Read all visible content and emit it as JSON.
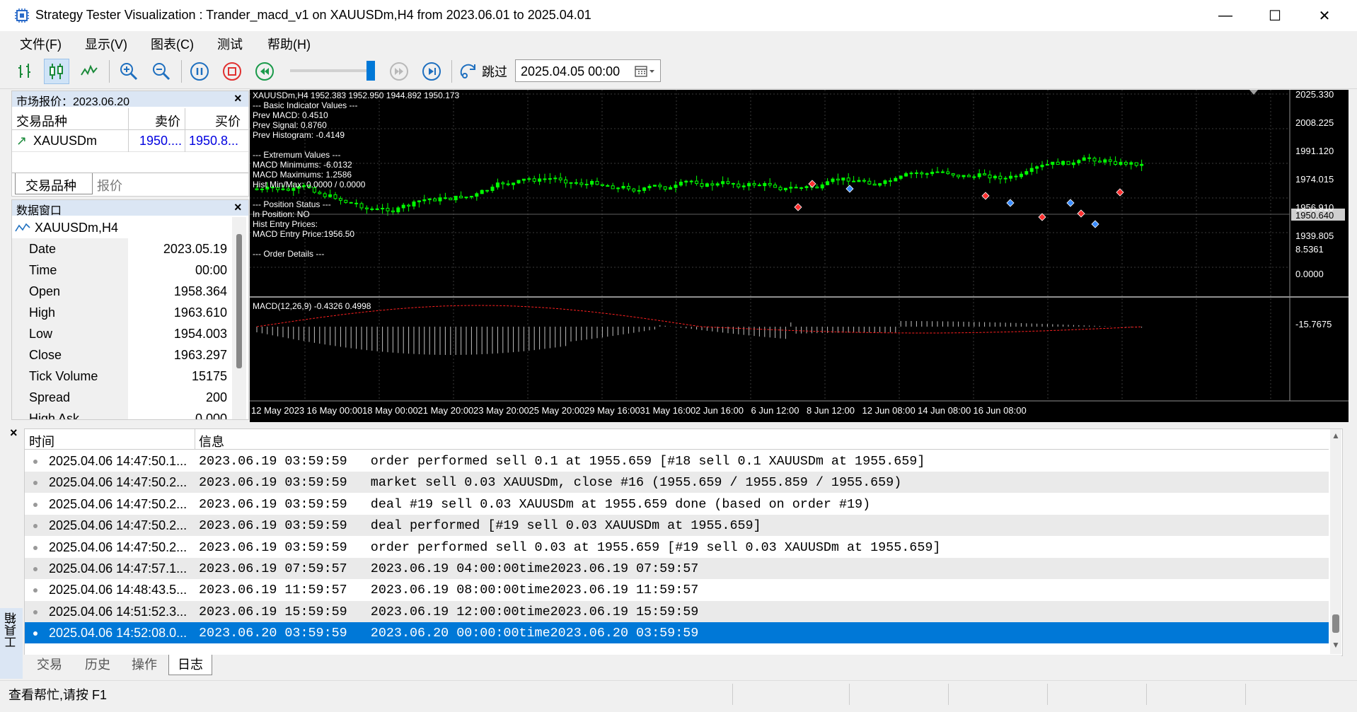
{
  "window": {
    "title": "Strategy Tester Visualization : Trander_macd_v1 on XAUUSDm,H4 from 2023.06.01 to 2025.04.01",
    "minimize_glyph": "—",
    "maximize_glyph": "☐",
    "close_glyph": "✕"
  },
  "menu": [
    "文件(F)",
    "显示(V)",
    "图表(C)",
    "测试",
    "帮助(H)"
  ],
  "toolbar": {
    "jump_label": "跳过",
    "date_value": "2025.04.05 00:00"
  },
  "market_watch": {
    "title": "市场报价：2023.06.20",
    "col_symbol": "交易品种",
    "col_bid": "卖价",
    "col_ask": "买价",
    "rows": [
      {
        "symbol": "XAUUSDm",
        "bid": "1950....",
        "ask": "1950.8..."
      }
    ],
    "tabs": [
      "交易品种",
      "报价"
    ]
  },
  "data_window": {
    "title": "数据窗口",
    "symbol": "XAUUSDm,H4",
    "rows": [
      {
        "label": "Date",
        "value": "2023.05.19"
      },
      {
        "label": "Time",
        "value": "00:00"
      },
      {
        "label": "Open",
        "value": "1958.364"
      },
      {
        "label": "High",
        "value": "1963.610"
      },
      {
        "label": "Low",
        "value": "1954.003"
      },
      {
        "label": "Close",
        "value": "1963.297"
      },
      {
        "label": "Tick Volume",
        "value": "15175"
      },
      {
        "label": "Spread",
        "value": "200"
      },
      {
        "label": "High Ask",
        "value": "0.000"
      }
    ]
  },
  "chart": {
    "header": "XAUUSDm,H4  1952.383 1952.950 1944.892 1950.173",
    "info_lines": [
      "--- Basic Indicator Values ---",
      "Prev MACD:    0.4510",
      "Prev Signal:   0.8760",
      "Prev Histogram: -0.4149",
      "",
      "--- Extremum Values ---",
      "MACD Minimums:   -6.0132",
      "MACD Maximums:   1.2586",
      "Hist Min/Max:  0.0000 / 0.0000",
      "",
      "--- Position Status ---",
      "In Position:      NO",
      "Hist Entry Prices:",
      "MACD Entry Price:1956.50",
      "",
      "--- Order Details ---"
    ],
    "macd_label": "MACD(12,26,9) -0.4326 0.4998",
    "current_price": "1950.640",
    "price_ticks": [
      "2025.330",
      "2008.225",
      "1991.120",
      "1974.015",
      "1956.910",
      "1939.805"
    ],
    "macd_ticks": [
      "8.5361",
      "0.0000",
      "-15.7675"
    ],
    "time_ticks": [
      "12 May 2023",
      "16 May 00:00",
      "18 May 00:00",
      "21 May 20:00",
      "23 May 20:00",
      "25 May 20:00",
      "29 May 16:00",
      "31 May 16:00",
      "2 Jun 16:00",
      "6 Jun 12:00",
      "8 Jun 12:00",
      "12 Jun 08:00",
      "14 Jun 08:00",
      "16 Jun 08:00"
    ],
    "colors": {
      "bull": "#00ff00",
      "bear": "#00ff00",
      "grid": "#3a3a3a",
      "macd_hist": "#c0c0c0",
      "signal": "#ff2020"
    }
  },
  "log": {
    "col_time": "时间",
    "col_message": "信息",
    "rows": [
      {
        "time": "2025.04.06 14:47:50.1...",
        "msg": "2023.06.19 03:59:59   order performed sell 0.1 at 1955.659 [#18 sell 0.1 XAUUSDm at 1955.659]"
      },
      {
        "time": "2025.04.06 14:47:50.2...",
        "msg": "2023.06.19 03:59:59   market sell 0.03 XAUUSDm, close #16 (1955.659 / 1955.859 / 1955.659)"
      },
      {
        "time": "2025.04.06 14:47:50.2...",
        "msg": "2023.06.19 03:59:59   deal #19 sell 0.03 XAUUSDm at 1955.659 done (based on order #19)"
      },
      {
        "time": "2025.04.06 14:47:50.2...",
        "msg": "2023.06.19 03:59:59   deal performed [#19 sell 0.03 XAUUSDm at 1955.659]"
      },
      {
        "time": "2025.04.06 14:47:50.2...",
        "msg": "2023.06.19 03:59:59   order performed sell 0.03 at 1955.659 [#19 sell 0.03 XAUUSDm at 1955.659]"
      },
      {
        "time": "2025.04.06 14:47:57.1...",
        "msg": "2023.06.19 07:59:57   2023.06.19 04:00:00time2023.06.19 07:59:57"
      },
      {
        "time": "2025.04.06 14:48:43.5...",
        "msg": "2023.06.19 11:59:57   2023.06.19 08:00:00time2023.06.19 11:59:57"
      },
      {
        "time": "2025.04.06 14:51:52.3...",
        "msg": "2023.06.19 15:59:59   2023.06.19 12:00:00time2023.06.19 15:59:59"
      },
      {
        "time": "2025.04.06 14:52:08.0...",
        "msg": "2023.06.20 03:59:59   2023.06.20 00:00:00time2023.06.20 03:59:59"
      }
    ],
    "tabs": [
      "交易",
      "历史",
      "操作",
      "日志"
    ],
    "side_label": "工具箱"
  },
  "statusbar": {
    "help": "查看帮忙,请按 F1"
  }
}
